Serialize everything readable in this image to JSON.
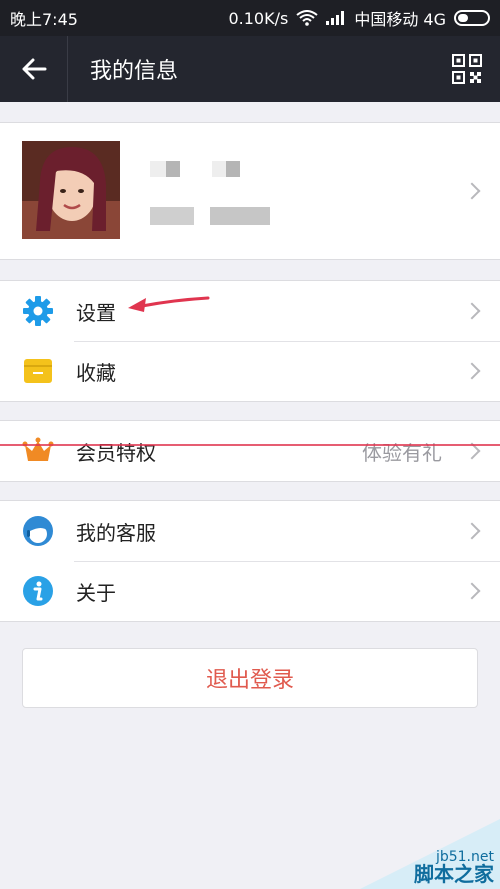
{
  "status_bar": {
    "time": "晚上7:45",
    "speed": "0.10K/s",
    "carrier": "中国移动 4G"
  },
  "nav": {
    "title": "我的信息",
    "back_icon": "arrow-left-icon",
    "qr_icon": "qr-code-icon"
  },
  "profile": {
    "avatar_icon": "user-avatar-photo"
  },
  "groups": {
    "g1": [
      {
        "label": "设置",
        "icon": "gear-icon",
        "color": "#1e9be8"
      },
      {
        "label": "收藏",
        "icon": "folder-icon",
        "color": "#f4c21b"
      }
    ],
    "g2": [
      {
        "label": "会员特权",
        "right": "体验有礼",
        "icon": "crown-icon",
        "color": "#f08a24"
      }
    ],
    "g3": [
      {
        "label": "我的客服",
        "icon": "support-avatar-icon",
        "color": "#2f8ad4"
      },
      {
        "label": "关于",
        "icon": "info-icon",
        "color": "#2aa1e6"
      }
    ]
  },
  "logout_label": "退出登录",
  "watermark": {
    "site": "jb51.net",
    "name": "脚本之家"
  },
  "colors": {
    "nav_bg": "#24262f",
    "logout_text": "#e05a4e",
    "annotation": "#e0354f"
  }
}
